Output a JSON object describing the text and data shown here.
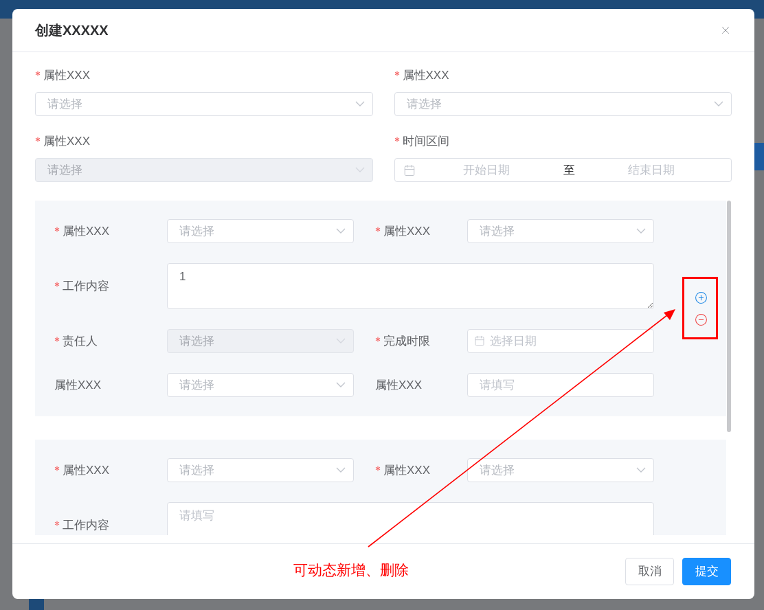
{
  "dialog": {
    "title": "创建XXXXX",
    "fields": [
      {
        "kind": "select",
        "label": "属性XXX",
        "required": true,
        "placeholder": "请选择",
        "disabled": false
      },
      {
        "kind": "select",
        "label": "属性XXX",
        "required": true,
        "placeholder": "请选择",
        "disabled": false
      },
      {
        "kind": "select",
        "label": "属性XXX",
        "required": true,
        "placeholder": "请选择",
        "disabled": true
      },
      {
        "kind": "daterange",
        "label": "时间区间",
        "required": true,
        "start_placeholder": "开始日期",
        "separator": "至",
        "end_placeholder": "结束日期"
      }
    ],
    "groups": [
      {
        "fields": [
          {
            "kind": "select",
            "label": "属性XXX",
            "required": true,
            "placeholder": "请选择",
            "disabled": false
          },
          {
            "kind": "select",
            "label": "属性XXX",
            "required": true,
            "placeholder": "请选择",
            "disabled": false
          },
          {
            "kind": "textarea",
            "label": "工作内容",
            "required": true,
            "value": "1"
          },
          {
            "kind": "select",
            "label": "责任人",
            "required": true,
            "placeholder": "请选择",
            "disabled": true
          },
          {
            "kind": "date",
            "label": "完成时限",
            "required": true,
            "placeholder": "选择日期"
          },
          {
            "kind": "select",
            "label": "属性XXX",
            "required": false,
            "placeholder": "请选择",
            "disabled": false
          },
          {
            "kind": "input",
            "label": "属性XXX",
            "required": false,
            "placeholder": "请填写"
          }
        ],
        "actions": true
      },
      {
        "fields": [
          {
            "kind": "select",
            "label": "属性XXX",
            "required": true,
            "placeholder": "请选择",
            "disabled": false
          },
          {
            "kind": "select",
            "label": "属性XXX",
            "required": true,
            "placeholder": "请选择",
            "disabled": false
          },
          {
            "kind": "textarea",
            "label": "工作内容",
            "required": true,
            "placeholder": "请填写"
          }
        ],
        "actions": false
      }
    ],
    "buttons": [
      {
        "kind": "default",
        "label": "取消"
      },
      {
        "kind": "primary",
        "label": "提交"
      }
    ]
  },
  "annotation": {
    "text": "可动态新增、删除"
  }
}
